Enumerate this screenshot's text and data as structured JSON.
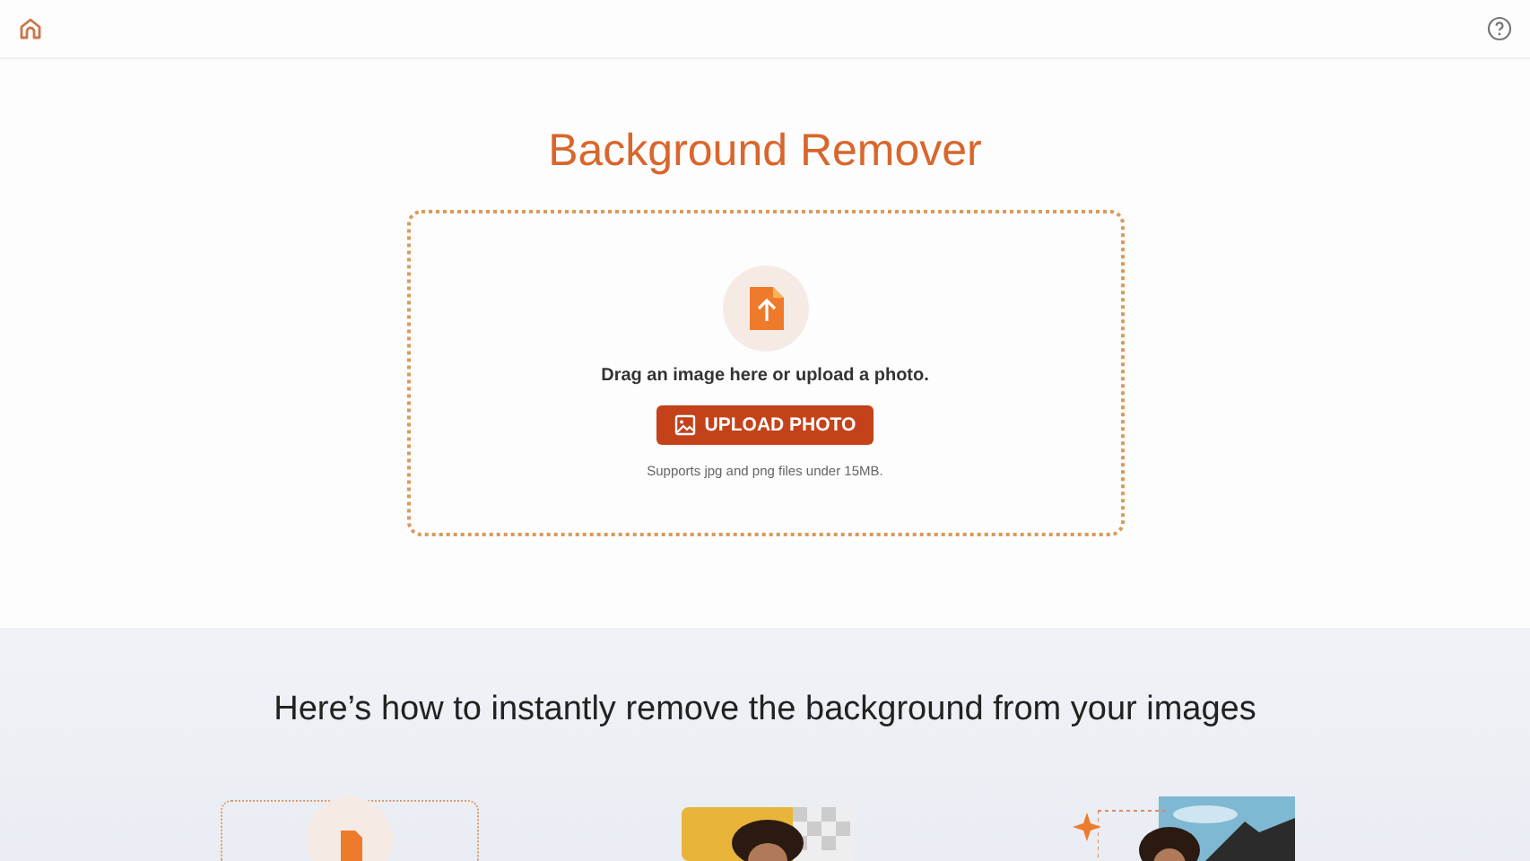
{
  "title": "Background Remover",
  "upload": {
    "prompt": "Drag an image here or upload a photo.",
    "button": "UPLOAD PHOTO",
    "note": "Supports jpg and png files under 15MB."
  },
  "how_to": {
    "heading": "Here’s how to instantly remove the background from your images"
  }
}
